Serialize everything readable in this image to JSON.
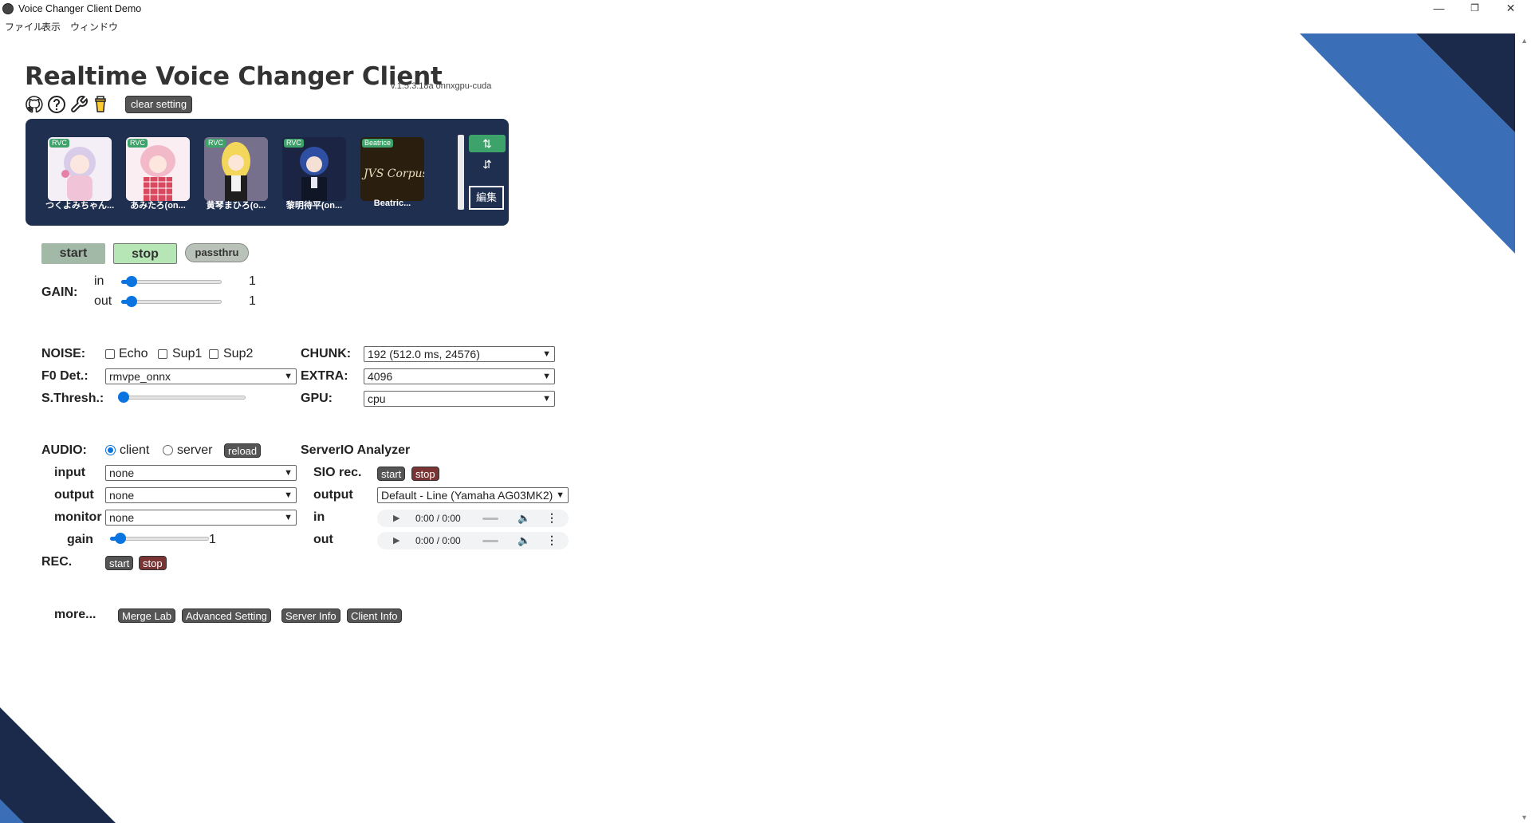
{
  "window": {
    "title": "Voice Changer Client Demo",
    "minimize": "—",
    "restore": "❐",
    "close": "✕"
  },
  "menu": [
    "ファイル",
    "表示",
    "ウィンドウ"
  ],
  "header": {
    "title": "Realtime Voice Changer Client",
    "version": "v.1.5.3.18a  onnxgpu-cuda",
    "clear_setting": "clear setting",
    "icons": [
      "github-icon",
      "help-icon",
      "wrench-icon",
      "coffee-icon"
    ]
  },
  "models": [
    {
      "badge": "RVC",
      "name": "つくよみちゃん...",
      "color": "#e9dff0"
    },
    {
      "badge": "RVC",
      "name": "あみたろ(on...",
      "color": "#f3d3dd"
    },
    {
      "badge": "RVC",
      "name": "黄琴まひろ(o...",
      "color": "#6c6783"
    },
    {
      "badge": "RVC",
      "name": "黎明待平(on...",
      "color": "#2a3458"
    },
    {
      "badge": "Beatrice",
      "name": "Beatric...",
      "color": "#2c2010",
      "art_text": "JVS Corpus"
    }
  ],
  "model_panel": {
    "sort_asc": "⇅",
    "sort_desc": "⇵",
    "edit": "編集"
  },
  "controls": {
    "start": "start",
    "stop": "stop",
    "passthru": "passthru"
  },
  "gain": {
    "label": "GAIN:",
    "in_label": "in",
    "in_value": "1",
    "in_fraction": 0.05,
    "out_label": "out",
    "out_value": "1",
    "out_fraction": 0.05
  },
  "noise": {
    "label": "NOISE:",
    "echo": "Echo",
    "sup1": "Sup1",
    "sup2": "Sup2"
  },
  "f0": {
    "label": "F0 Det.:",
    "value": "rmvpe_onnx"
  },
  "sthresh": {
    "label": "S.Thresh.:",
    "fraction": 0.0
  },
  "chunk": {
    "label": "CHUNK:",
    "value": "192 (512.0 ms, 24576)"
  },
  "extra": {
    "label": "EXTRA:",
    "value": "4096"
  },
  "gpu": {
    "label": "GPU:",
    "value": "cpu"
  },
  "audio": {
    "label": "AUDIO:",
    "client": "client",
    "server": "server",
    "reload": "reload",
    "input_label": "input",
    "input_value": "none",
    "output_label": "output",
    "output_value": "none",
    "monitor_label": "monitor",
    "monitor_value": "none",
    "gain_label": "gain",
    "gain_value": "1",
    "gain_fraction": 0.05
  },
  "rec": {
    "label": "REC.",
    "start": "start",
    "stop": "stop"
  },
  "analyzer": {
    "title": "ServerIO Analyzer",
    "sio_label": "SIO rec.",
    "start": "start",
    "stop": "stop",
    "output_label": "output",
    "output_value": "Default - Line (Yamaha AG03MK2)",
    "in_label": "in",
    "out_label": "out",
    "time": "0:00 / 0:00"
  },
  "more": {
    "label": "more...",
    "merge_lab": "Merge Lab",
    "advanced": "Advanced Setting",
    "server_info": "Server Info",
    "client_info": "Client Info"
  },
  "colors": {
    "panel": "#1f2f50",
    "accent_blue": "#3a6fb8",
    "dark_navy": "#1b2a4a",
    "start_bg": "#a3b9a7",
    "stop_bg": "#b6e6b6",
    "passthru_bg": "#b9c2b9",
    "red_button": "#7a3434",
    "slider": "#0a74e0"
  }
}
